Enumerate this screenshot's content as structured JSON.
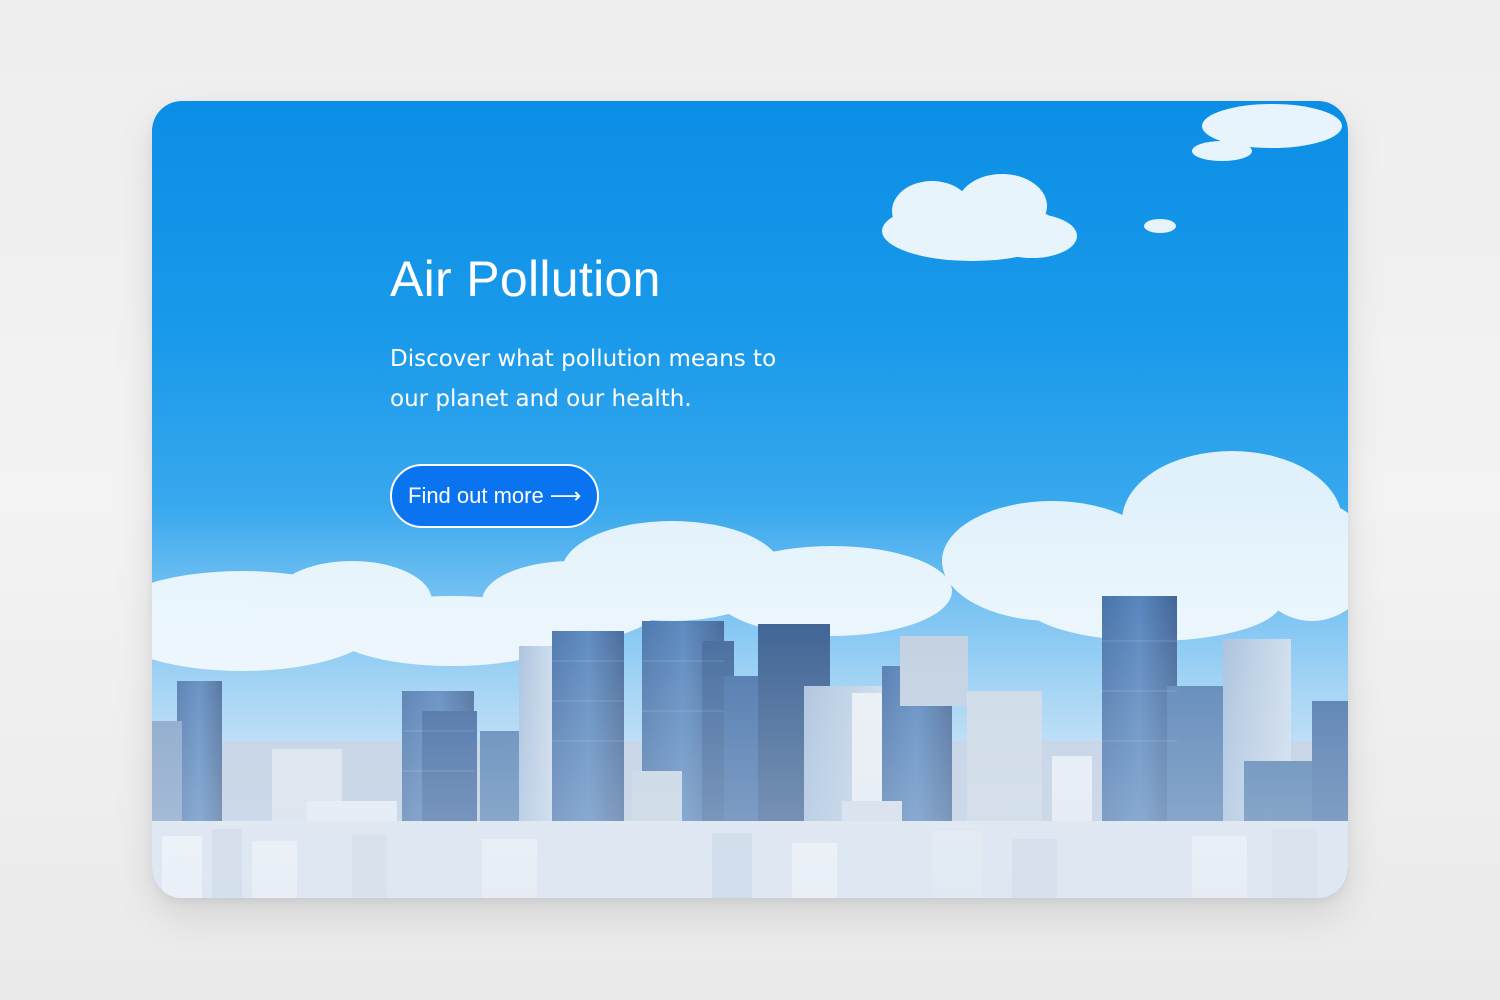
{
  "hero": {
    "title": "Air Pollution",
    "subtitle": "Discover what pollution means to our planet and our health.",
    "cta_label": "Find out more",
    "cta_icon": "arrow-right-icon",
    "cta_arrow": "⟶"
  },
  "colors": {
    "sky_top": "#0b8ee6",
    "button": "#0a74f0",
    "text": "#ffffff"
  }
}
